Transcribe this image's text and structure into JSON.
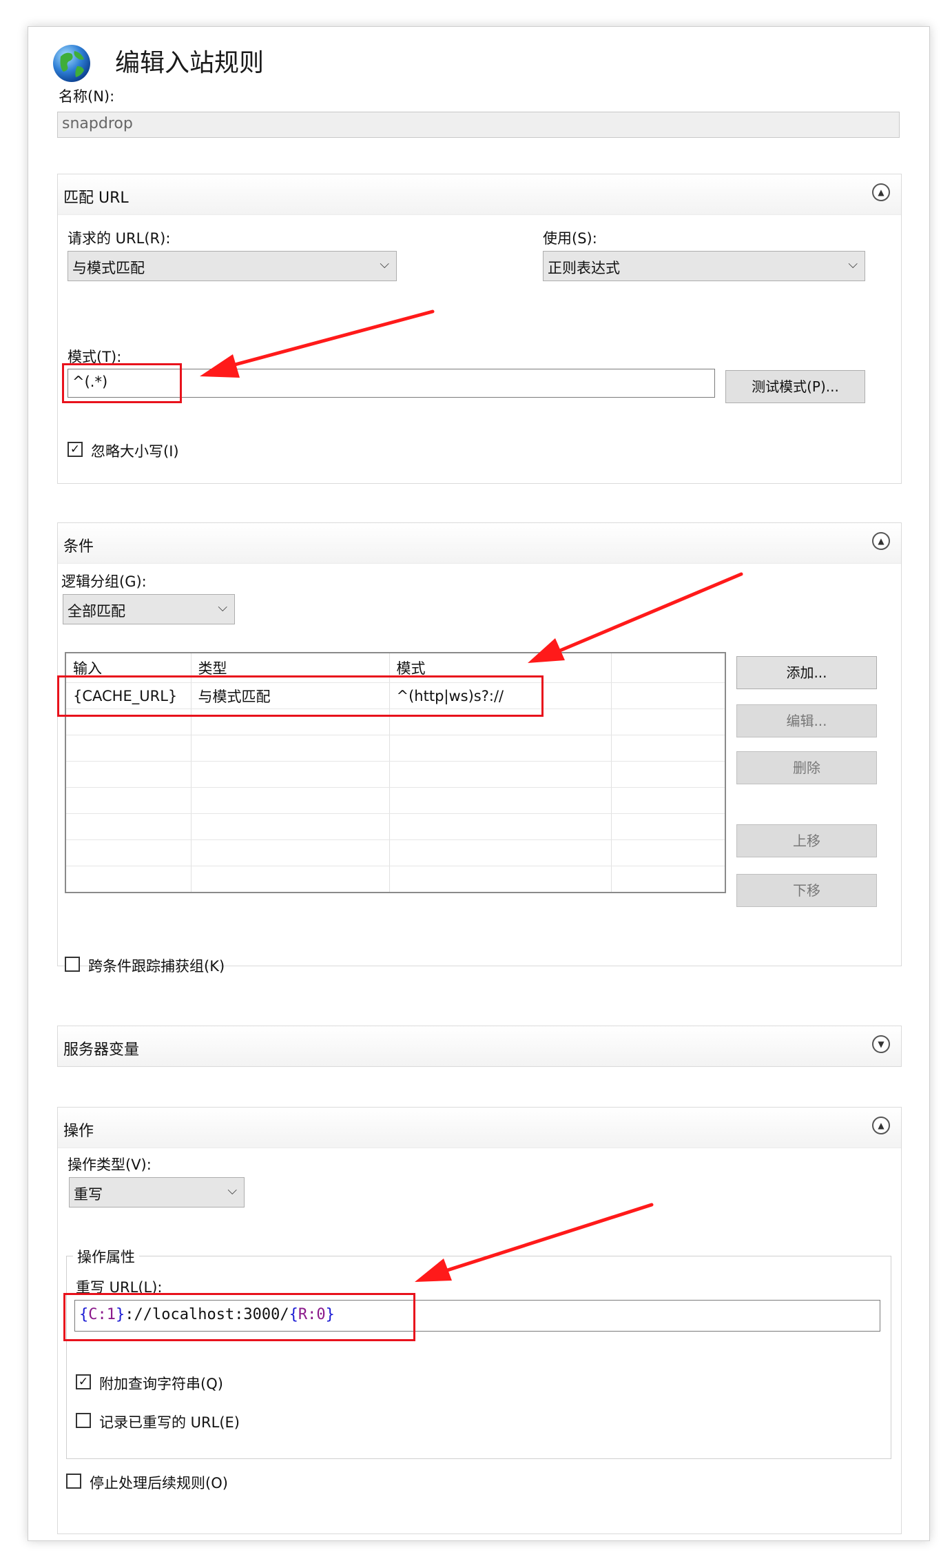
{
  "dialog": {
    "title": "编辑入站规则",
    "icon": "globe-icon"
  },
  "name": {
    "label": "名称(N):",
    "value": "snapdrop"
  },
  "match_url": {
    "title": "匹配 URL",
    "requested_url_label": "请求的 URL(R):",
    "requested_url_value": "与模式匹配",
    "using_label": "使用(S):",
    "using_value": "正则表达式",
    "pattern_label": "模式(T):",
    "pattern_value": "^(.*)",
    "test_button": "测试模式(P)...",
    "ignore_case_label": "忽略大小写(I)",
    "ignore_case_checked": true
  },
  "conditions": {
    "title": "条件",
    "logical_grouping_label": "逻辑分组(G):",
    "logical_grouping_value": "全部匹配",
    "columns": [
      "输入",
      "类型",
      "模式"
    ],
    "rows": [
      {
        "input": "{CACHE_URL}",
        "type": "与模式匹配",
        "pattern": "^(http|ws)s?://"
      }
    ],
    "buttons": {
      "add": "添加...",
      "edit": "编辑...",
      "remove": "删除",
      "move_up": "上移",
      "move_down": "下移"
    },
    "track_captures_label": "跨条件跟踪捕获组(K)",
    "track_captures_checked": false
  },
  "server_variables": {
    "title": "服务器变量"
  },
  "action": {
    "title": "操作",
    "action_type_label": "操作类型(V):",
    "action_type_value": "重写",
    "properties_label": "操作属性",
    "rewrite_url_label": "重写 URL(L):",
    "rewrite_url_parts": {
      "p1": "{",
      "p2": "C:1",
      "p3": "}",
      "p4": "://localhost:3000/",
      "p5": "{",
      "p6": "R:0",
      "p7": "}"
    },
    "append_query_label": "附加查询字符串(Q)",
    "append_query_checked": true,
    "log_rewritten_label": "记录已重写的 URL(E)",
    "log_rewritten_checked": false,
    "stop_processing_label": "停止处理后续规则(O)",
    "stop_processing_checked": false
  },
  "colors": {
    "highlight": "#e8121c",
    "arrow": "#ff1a1a"
  }
}
